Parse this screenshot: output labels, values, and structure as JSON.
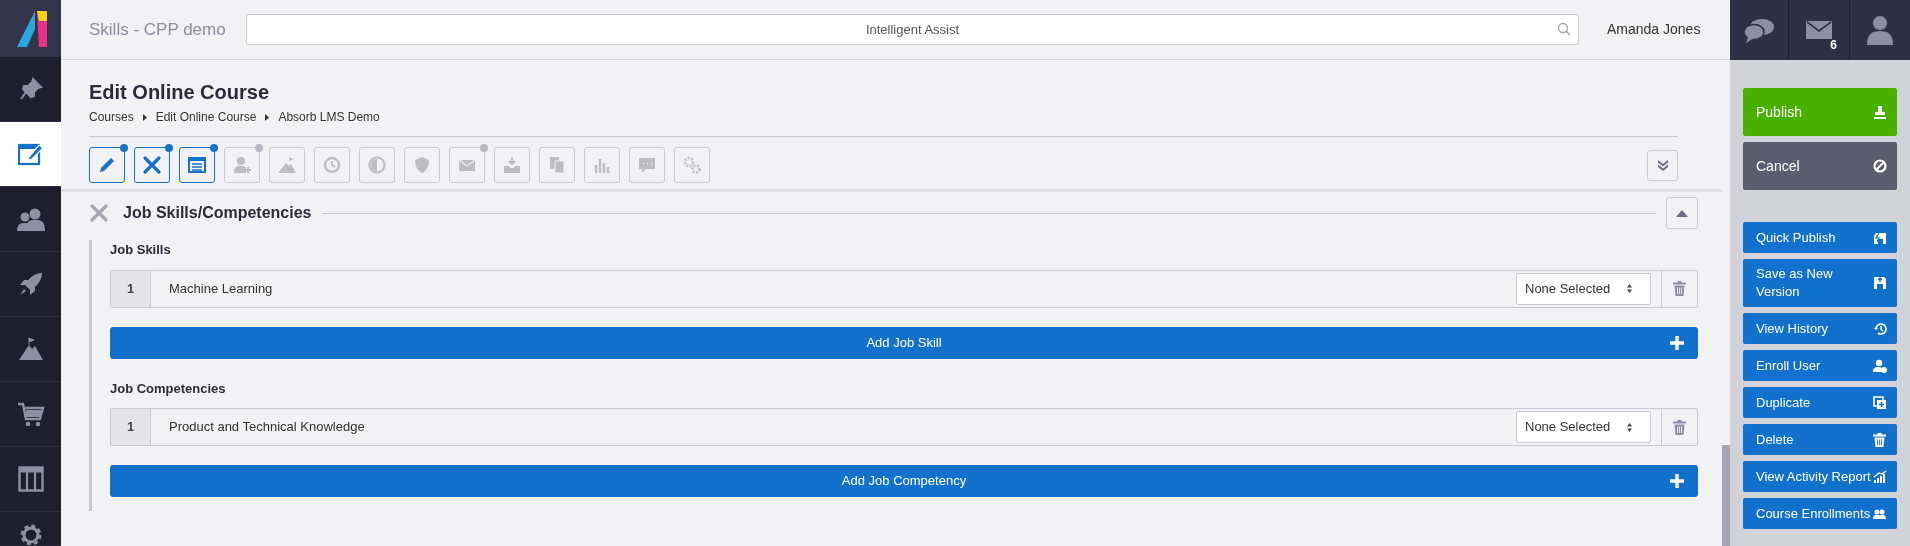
{
  "header": {
    "title": "Skills - CPP demo",
    "search": {
      "placeholder": "Intelligent Assist"
    },
    "user": "Amanda Jones",
    "message_count": "6"
  },
  "sidebar": {
    "items": [
      {
        "selected": false
      },
      {
        "selected": true
      },
      {
        "selected": false
      },
      {
        "selected": false
      },
      {
        "selected": false
      },
      {
        "selected": false
      },
      {
        "selected": false
      },
      {
        "selected": false
      }
    ]
  },
  "page": {
    "title": "Edit Online Course",
    "breadcrumbs": [
      "Courses",
      "Edit Online Course",
      "Absorb LMS Demo"
    ]
  },
  "toolbar": {
    "buttons": [
      {
        "active": true,
        "badge": true
      },
      {
        "active": true,
        "badge": true
      },
      {
        "active": true,
        "badge": true
      },
      {
        "active": false,
        "badge": true
      },
      {
        "active": false,
        "badge": false
      },
      {
        "active": false,
        "badge": false
      },
      {
        "active": false,
        "badge": false
      },
      {
        "active": false,
        "badge": false
      },
      {
        "active": false,
        "badge": true
      },
      {
        "active": false,
        "badge": false
      },
      {
        "active": false,
        "badge": false
      },
      {
        "active": false,
        "badge": false
      },
      {
        "active": false,
        "badge": false
      },
      {
        "active": false,
        "badge": false
      }
    ]
  },
  "section": {
    "title": "Job Skills/Competencies",
    "groups": [
      {
        "label": "Job Skills",
        "rows": [
          {
            "number": "1",
            "name": "Machine Learning",
            "select": "None Selected"
          }
        ],
        "add_button": "Add Job Skill"
      },
      {
        "label": "Job Competencies",
        "rows": [
          {
            "number": "1",
            "name": "Product and Technical Knowledge",
            "select": "None Selected"
          }
        ],
        "add_button": "Add Job Competency"
      }
    ]
  },
  "actions": {
    "primary": [
      {
        "kind": "publish",
        "label": "Publish"
      },
      {
        "kind": "cancel",
        "label": "Cancel"
      }
    ],
    "buttons": [
      "Quick Publish",
      "Save as New Version",
      "View History",
      "Enroll User",
      "Duplicate",
      "Delete",
      "View Activity Report",
      "Course Enrollments"
    ]
  }
}
